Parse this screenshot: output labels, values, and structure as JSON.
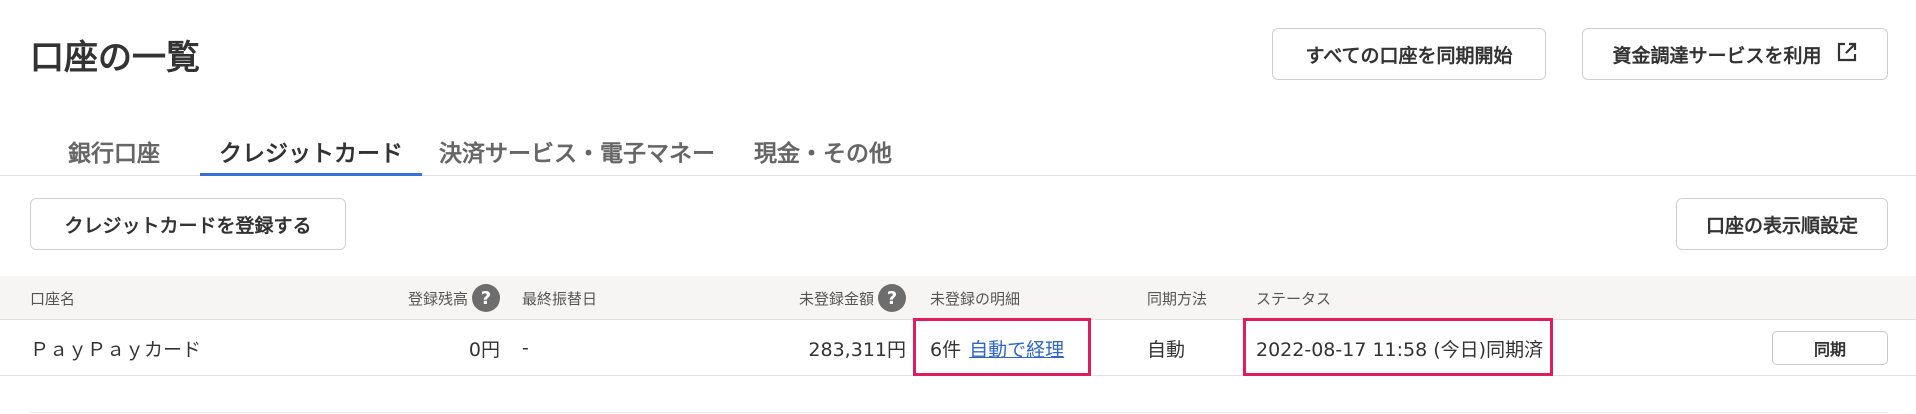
{
  "header": {
    "title": "口座の一覧",
    "sync_all_label": "すべての口座を同期開始",
    "funding_label": "資金調達サービスを利用",
    "funding_icon": "external-link-icon"
  },
  "tabs": [
    {
      "label": "銀行口座",
      "active": false
    },
    {
      "label": "クレジットカード",
      "active": true
    },
    {
      "label": "決済サービス・電子マネー",
      "active": false
    },
    {
      "label": "現金・その他",
      "active": false
    }
  ],
  "toolbar": {
    "register_label": "クレジットカードを登録する",
    "order_label": "口座の表示順設定"
  },
  "table": {
    "columns": {
      "name": "口座名",
      "balance": "登録残高",
      "last_transfer": "最終振替日",
      "unregistered_amount": "未登録金額",
      "unregistered_details": "未登録の明細",
      "sync_method": "同期方法",
      "status": "ステータス"
    },
    "help_glyph": "?",
    "accent_color": "#e01b5f",
    "rows": [
      {
        "name": "ＰａｙＰａｙカード",
        "balance": "0円",
        "last_transfer": "-",
        "unregistered_amount": "283,311円",
        "unregistered_count": "6件",
        "unregistered_link": "自動で経理",
        "sync_method": "自動",
        "status": "2022-08-17 11:58 (今日)同期済",
        "sync_button": "同期"
      }
    ]
  }
}
